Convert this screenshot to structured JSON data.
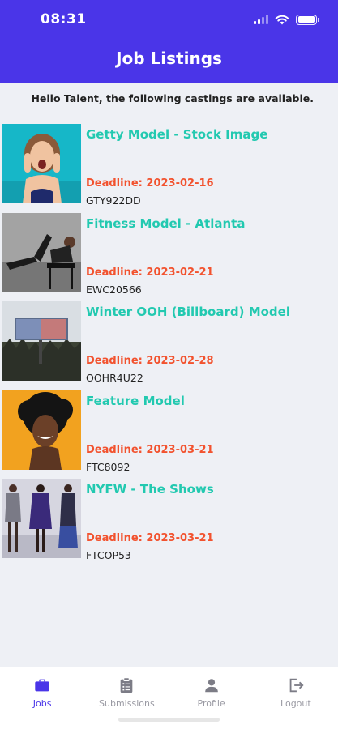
{
  "status_bar": {
    "time": "08:31"
  },
  "header": {
    "title": "Job Listings"
  },
  "greeting": "Hello Talent, the following castings are available.",
  "listings": [
    {
      "title": "Getty Model - Stock Image",
      "deadline": "Deadline: 2023-02-16",
      "code": "GTY922DD",
      "image": "woman-excited-teal-background"
    },
    {
      "title": "Fitness Model - Atlanta",
      "deadline": "Deadline: 2023-02-21",
      "code": "EWC20566",
      "image": "fitness-model-on-chair"
    },
    {
      "title": "Winter OOH (Billboard) Model",
      "deadline": "Deadline: 2023-02-28",
      "code": "OOHR4U22",
      "image": "roadside-billboard"
    },
    {
      "title": "Feature Model",
      "deadline": "Deadline: 2023-03-21",
      "code": "FTC8092",
      "image": "woman-curly-hair-orange-background"
    },
    {
      "title": "NYFW - The Shows",
      "deadline": "Deadline: 2023-03-21",
      "code": "FTCOP53",
      "image": "runway-models"
    }
  ],
  "tabs": [
    {
      "label": "Jobs",
      "icon": "briefcase-icon",
      "active": true
    },
    {
      "label": "Submissions",
      "icon": "clipboard-icon",
      "active": false
    },
    {
      "label": "Profile",
      "icon": "person-icon",
      "active": false
    },
    {
      "label": "Logout",
      "icon": "logout-icon",
      "active": false
    }
  ],
  "colors": {
    "primary": "#4a35e8",
    "title_teal": "#22c9b0",
    "deadline_red": "#f2522e",
    "background": "#eef0f5"
  }
}
